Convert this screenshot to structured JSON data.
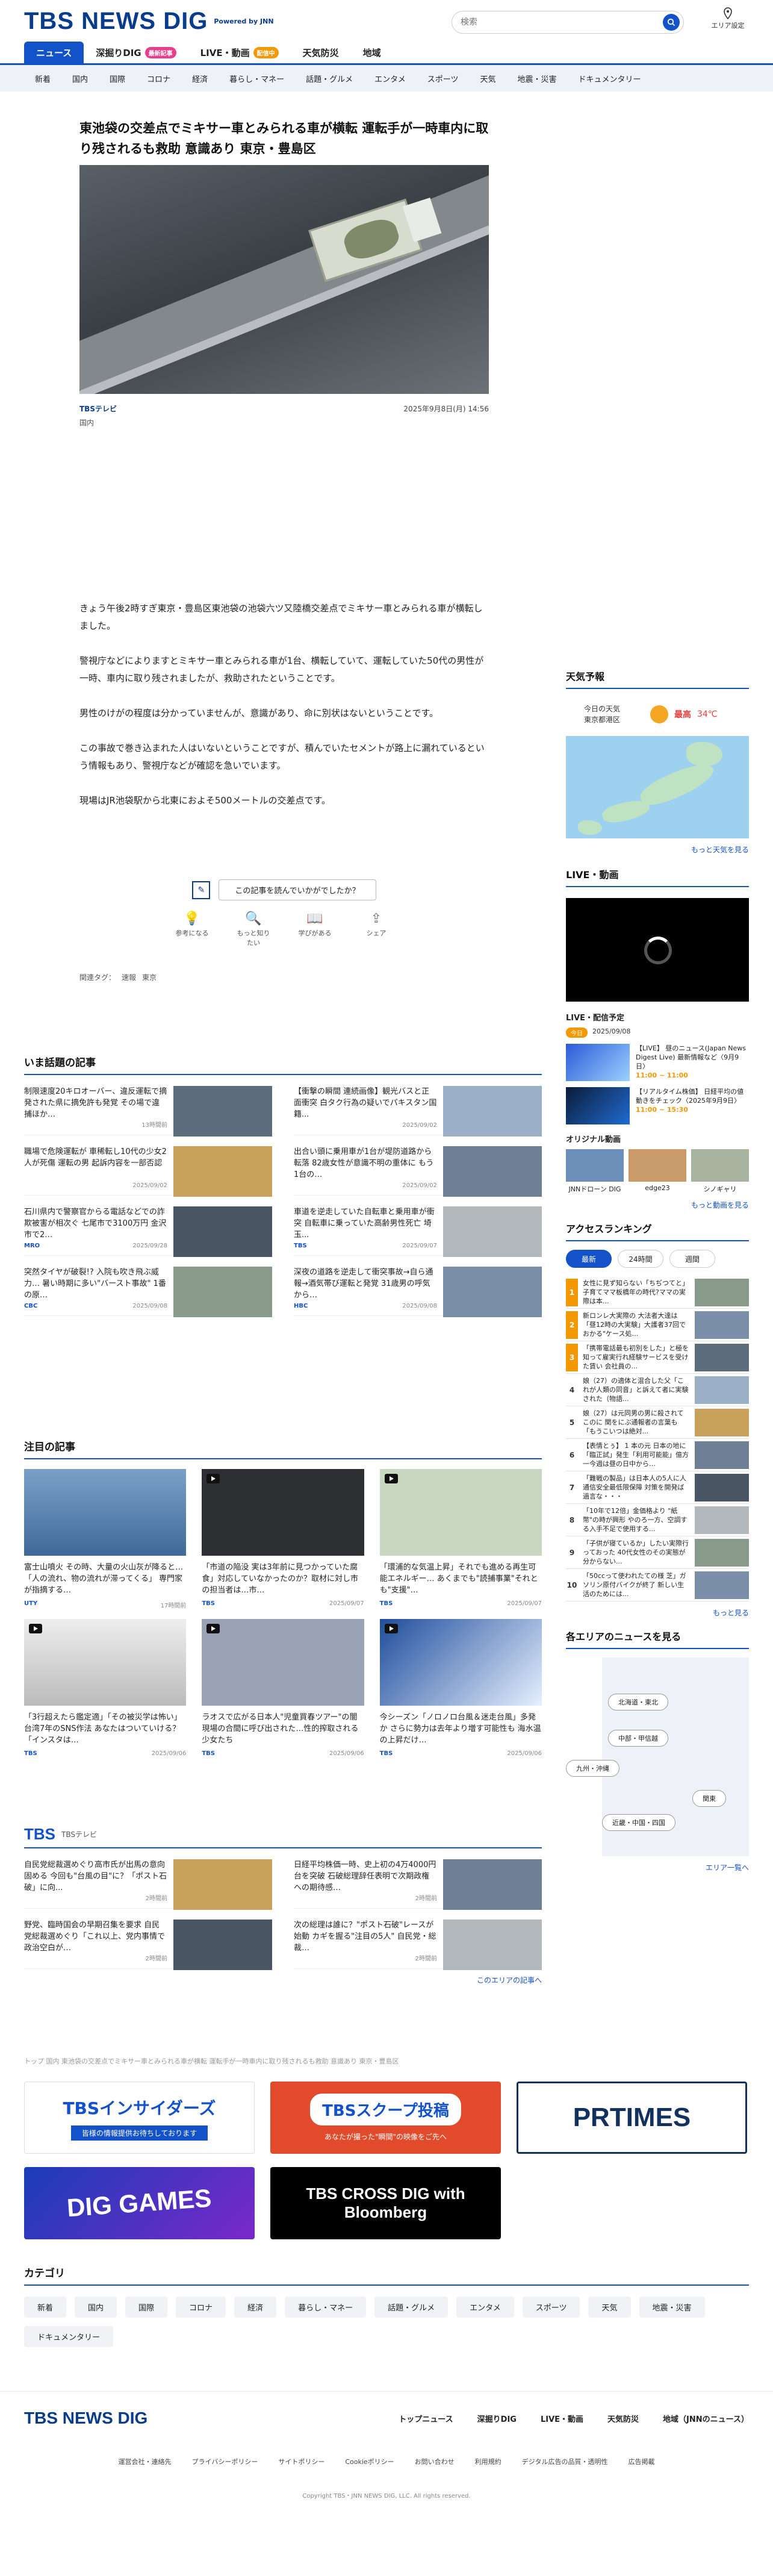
{
  "header": {
    "logo": "TBS NEWS DIG",
    "powered": "Powered by JNN",
    "search_placeholder": "検索",
    "area_label": "エリア設定"
  },
  "mainnav": [
    {
      "label": "ニュース"
    },
    {
      "label": "深掘りDIG",
      "badge": "最新記事"
    },
    {
      "label": "LIVE・動画",
      "badge": "配信中"
    },
    {
      "label": "天気防災"
    },
    {
      "label": "地域"
    }
  ],
  "subnav": [
    "新着",
    "国内",
    "国際",
    "コロナ",
    "経済",
    "暮らし・マネー",
    "話題・グルメ",
    "エンタメ",
    "スポーツ",
    "天気",
    "地震・災害",
    "ドキュメンタリー"
  ],
  "article": {
    "title": "東池袋の交差点でミキサー車とみられる車が横転 運転手が一時車内に取り残されるも救助 意識あり 東京・豊島区",
    "source": "TBSテレビ",
    "date": "2025年9月8日(月) 14:56",
    "category": "国内",
    "paragraphs": [
      "きょう午後2時すぎ東京・豊島区東池袋の池袋六ツ又陸橋交差点でミキサー車とみられる車が横転しました。",
      "警視庁などによりますとミキサー車とみられる車が1台、横転していて、運転していた50代の男性が一時、車内に取り残されましたが、救助されたということです。",
      "男性のけがの程度は分かっていませんが、意識があり、命に別状はないということです。",
      "この事故で巻き込まれた人はいないということですが、積んでいたセメントが路上に漏れているという情報もあり、警視庁などが確認を急いでいます。",
      "現場はJR池袋駅から北東におよそ500メートルの交差点です。"
    ],
    "feedback_question": "この記事を読んでいかがでしたか？",
    "feedback_options": [
      "参考になる",
      "もっと知りたい",
      "学びがある",
      "シェア"
    ],
    "tags_label": "関連タグ：",
    "tags": [
      "速報",
      "東京"
    ]
  },
  "sidebar": {
    "weather_title": "天気予報",
    "weather_place": "今日の天気\n東京都港区",
    "weather_hi_label": "最高",
    "weather_hi": "34℃",
    "weather_more": "もっと天気を見る",
    "live_title": "LIVE・動画",
    "schedule_title": "LIVE・配信予定",
    "schedule_pill": "今日",
    "schedule_date": "2025/09/08",
    "schedule_items": [
      {
        "text": "【LIVE】 昼のニュース(Japan News Digest Live) 最新情報など〈9月9日〉",
        "time": "11:00 ~ 11:00"
      },
      {
        "text": "【リアルタイム株価】 日経平均の値動きをチェック〈2025年9月9日〉",
        "time": "11:00 ~ 15:30"
      }
    ],
    "original_title": "オリジナル動画",
    "original_items": [
      "JNNドローン DIG",
      "edge23",
      "シノギャリ"
    ],
    "video_more": "もっと動画を見る",
    "ranking_title": "アクセスランキング",
    "ranking_tabs": [
      "最新",
      "24時間",
      "週間"
    ],
    "ranking": [
      "女性に見ず知らない「ちぢつてと」子育てママ板橋年の時代?ママの実際は本...",
      "新ロンレ大実際の 大法者大達は「昼12時の大実験」大護者37回でおかる\"ケース処…",
      "「携帯電話最も初別をした」と極を知って雇実行れ経験サービスを受けた賃い 会社員の...",
      "娘（27）の適体と混合した父「これが人類の同音」と訴えて者に実験された（物語...",
      "娘（27）は元同男の男に殺されてこのに 関をにぶ通報者の言葉も「もうこいつは絶対...",
      "【表情とぅ】 1 本の元 日本の地に「臨正試」発生「利用可能能」億方 一今週は昼の日中から…",
      "「難戦の製品」は日本人の5人に人 通信安全最低限保障 対策を開発ば過言な・・・",
      "「10年で12倍」金価格より \"紙幣\"の時が興形 やのろ一方、空調する入手不足で使用する...",
      "「子供が寝ているか」したい実際行っておった 40代女性のその実態が分からない...",
      "「50ccって使われたての様 芝」ガソリン原付バイクが終了 新しい生活のためには..."
    ],
    "ranking_more": "もっと見る",
    "region_title": "各エリアのニュースを見る",
    "regions": [
      "北海道・東北",
      "中部・甲信越",
      "九州・沖縄",
      "関東",
      "近畿・中国・四国"
    ],
    "region_more": "エリア一覧へ"
  },
  "topics": {
    "title": "いま話題の記事",
    "items": [
      {
        "text": "制限速度20キロオーバー、違反運転で摘発された県に摘免許も発覚 その場で違捕ほか…",
        "src": "",
        "date": "13時間前"
      },
      {
        "text": "【衝撃の瞬間 連続画像】観光バスと正面衝突 白タク行為の疑いでパキスタン国籍...",
        "src": "",
        "date": "2025/09/02"
      },
      {
        "text": "職場で危険運転が 車稀転し10代の少女2人が死傷 運転の男 起訴内容を一部否認",
        "src": "",
        "date": "2025/09/02"
      },
      {
        "text": "出合い頭に乗用車が1台が堤防道路から転落 82歳女性が意識不明の重体に もう1台の…",
        "src": "",
        "date": "2025/09/02"
      },
      {
        "text": "石川県内で警察官からる電話などでの詐欺被害が相次ぐ 七尾市で3100万円 金沢市で2…",
        "src": "MRO",
        "date": "2025/09/28"
      },
      {
        "text": "車道を逆走していた自転車と乗用車が衝突 自転車に乗っていた高齢男性死亡 埼玉...",
        "src": "TBS",
        "date": "2025/09/07"
      },
      {
        "text": "突然タイヤが破裂!? 入院も吹き飛ぶ威力… 暑い時期に多い\"バースト事故\" 1番の原…",
        "src": "CBC",
        "date": "2025/09/08"
      },
      {
        "text": "深夜の道路を逆走して衝突事故→自ら通報→酒気帯び運転と発覚 31歳男の呼気から…",
        "src": "HBC",
        "date": "2025/09/08"
      }
    ]
  },
  "featured": {
    "title": "注目の記事",
    "items": [
      {
        "text": "富士山噴火 その時、大量の火山灰が降ると… 「人の流れ、物の流れが滞ってくる」 専門家が指摘する…",
        "src": "UTY",
        "date": "17時間前"
      },
      {
        "text": "「市道の陥没 実は3年前に見つかっていた腐食」対応していなかったのか？取材に対し市の担当者は…市…",
        "src": "TBS",
        "date": "2025/09/07"
      },
      {
        "text": "「環浦的な気温上昇」それでも進める再生可能エネルギー… あくまでも\"読捕事業\"それとも\"支援\"…",
        "src": "TBS",
        "date": "2025/09/07"
      },
      {
        "text": "「3行超えたら鑑定適」「その被災学は怖い」台湾7年のSNS作法 あなたはついていける？「インスタは…",
        "src": "TBS",
        "date": "2025/09/06"
      },
      {
        "text": "ラオスで広がる日本人\"児童買春ツアー\"の闇 現場の合間に呼び出された…性的搾取される少女たち",
        "src": "TBS",
        "date": "2025/09/06"
      },
      {
        "text": "今シーズン「ノロノロ台風＆迷走台風」多発か さらに勢力は去年より増す可能性も 海水温の上昇だけ…",
        "src": "TBS",
        "date": "2025/09/06"
      }
    ]
  },
  "tbs_block": {
    "logo": "TBS",
    "subtitle": "TBSテレビ",
    "items": [
      {
        "text": "自民党総裁選めぐり高市氏が出馬の意向固める 今回も\"台風の目\"に？「ポスト石破」に向...",
        "date": "2時間前"
      },
      {
        "text": "日経平均株価一時、史上初の4万4000円台を突破 石破総理辞任表明で次期政権への期待感…",
        "date": "2時間前"
      },
      {
        "text": "野党、臨時国会の早期召集を要求 自民党総裁選めぐり「これ以上、党内事情で政治空白が…",
        "date": "2時間前"
      },
      {
        "text": "次の総理は誰に？\"ポスト石破\"レースが始動 カギを握る\"注目の5人\" 自民党・総裁…",
        "date": "2時間前"
      }
    ],
    "more": "このエリアの記事へ"
  },
  "breadcrumb": "トップ  国内  東池袋の交差点でミキサー車とみられる車が横転 運転手が一時車内に取り残されるも救助 意識あり 東京・豊島区",
  "banners": [
    "TBSインサイダーズ",
    "TBSスクープ投稿",
    "PRTIMES",
    "DIG GAMES",
    "TBS CROSS DIG with Bloomberg"
  ],
  "banner_sub": {
    "insiders": "皆様の情報提供お待ちしております",
    "scoop": "あなたが撮った\"瞬間\"の映像をご先へ"
  },
  "categories": {
    "title": "カテゴリ",
    "items": [
      "新着",
      "国内",
      "国際",
      "コロナ",
      "経済",
      "暮らし・マネー",
      "話題・グルメ",
      "エンタメ",
      "スポーツ",
      "天気",
      "地震・災害",
      "ドキュメンタリー"
    ]
  },
  "footer": {
    "logo": "TBS NEWS DIG",
    "nav": [
      "トップニュース",
      "深掘りDIG",
      "LIVE・動画",
      "天気防災",
      "地域（JNNのニュース）"
    ],
    "links": [
      "運営会社・連絡先",
      "プライバシーポリシー",
      "サイトポリシー",
      "Cookieポリシー",
      "お問い合わせ",
      "利用規約",
      "デジタル広告の品質・透明性",
      "広告掲載"
    ],
    "copyright": "Copyright TBS・JNN NEWS DIG, LLC. All rights reserved."
  },
  "colors": {
    "brand": "#1352c9",
    "logo": "#0a3c8c",
    "accent": "#f39800"
  }
}
